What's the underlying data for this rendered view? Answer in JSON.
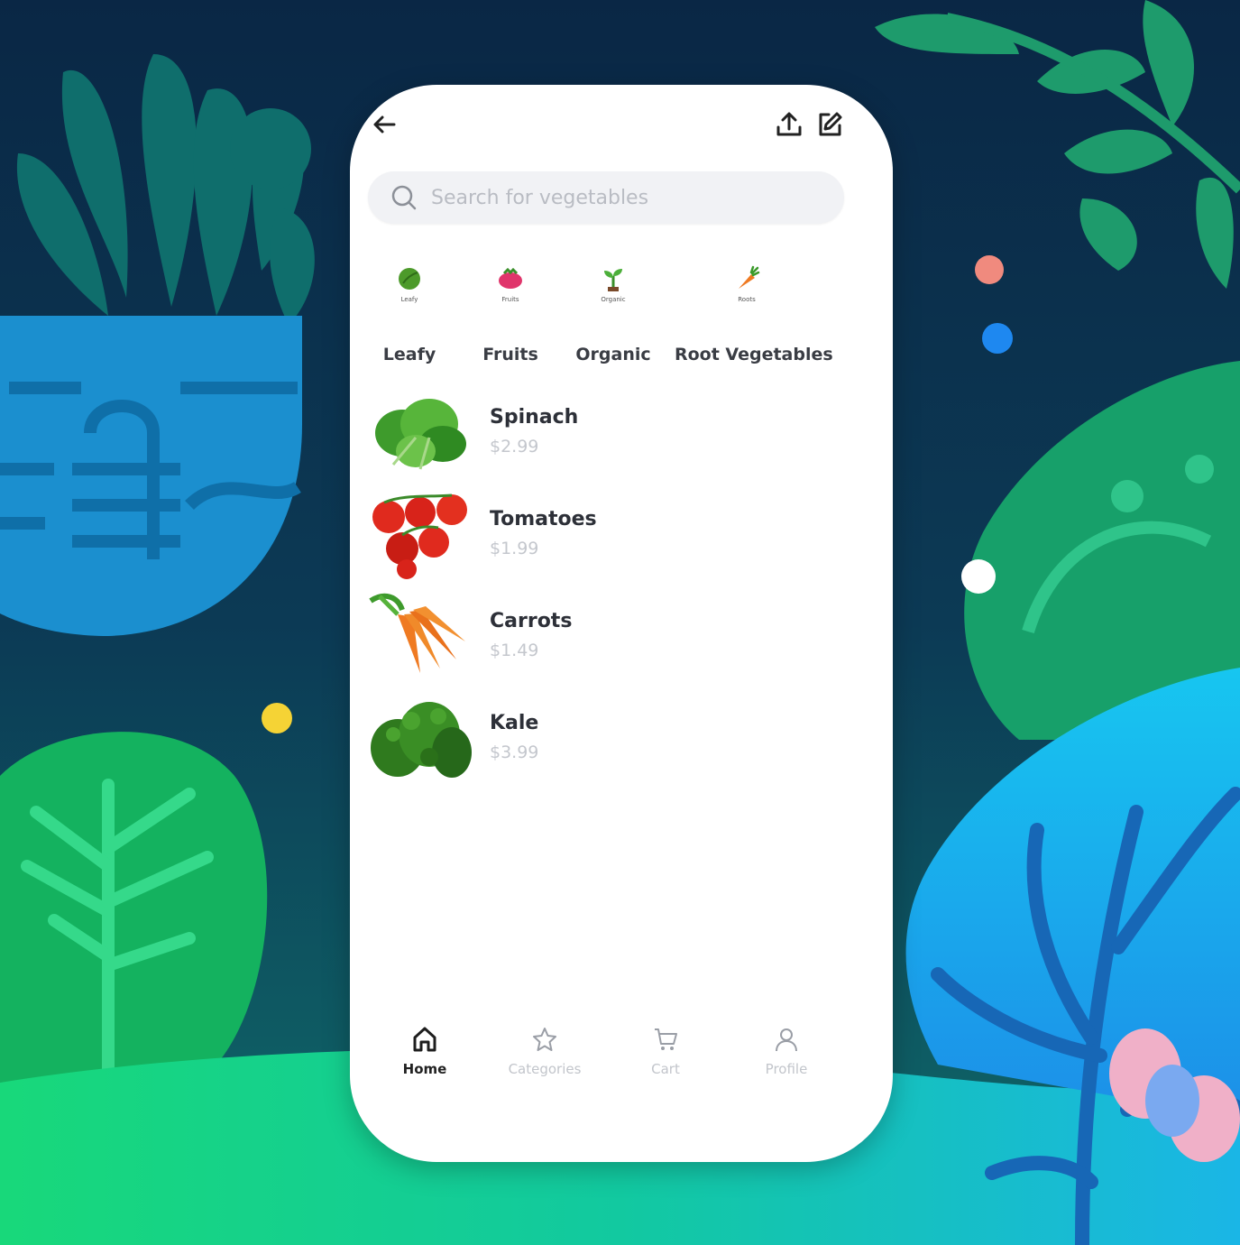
{
  "search": {
    "placeholder": "Search for vegetables"
  },
  "header": {
    "back_icon": "arrow-left-icon",
    "share_icon": "upload-icon",
    "edit_icon": "edit-icon"
  },
  "categories": [
    {
      "label": "Leafy",
      "tiny": "Leafy",
      "icon": "leaf-icon"
    },
    {
      "label": "Fruits",
      "tiny": "Fruits",
      "icon": "berry-icon"
    },
    {
      "label": "Organic",
      "tiny": "Organic",
      "icon": "sprout-icon"
    },
    {
      "label": "Root Vegetables",
      "tiny": "Roots",
      "icon": "carrot-icon"
    }
  ],
  "products": [
    {
      "name": "Spinach",
      "price": "$2.99"
    },
    {
      "name": "Tomatoes",
      "price": "$1.99"
    },
    {
      "name": "Carrots",
      "price": "$1.49"
    },
    {
      "name": "Kale",
      "price": "$3.99"
    }
  ],
  "tabs": [
    {
      "label": "Home",
      "icon": "home-icon",
      "active": true
    },
    {
      "label": "Categories",
      "icon": "star-icon",
      "active": false
    },
    {
      "label": "Cart",
      "icon": "cart-icon",
      "active": false
    },
    {
      "label": "Profile",
      "icon": "user-icon",
      "active": false
    }
  ],
  "colors": {
    "bg_dark": "#0b2a46",
    "bg_green": "#16c47a",
    "bg_blue": "#1aa3e8",
    "dot_coral": "#f08a7e",
    "dot_blue": "#1e88f0",
    "dot_yellow": "#f5d335"
  }
}
